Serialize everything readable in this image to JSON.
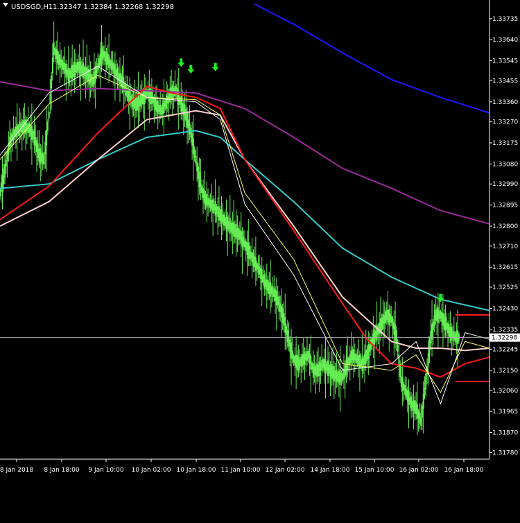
{
  "chart_header": {
    "symbol": "USDSGD,H1",
    "ohlc": "1.32347 1.32384 1.32268 1.32298"
  },
  "current_price_label": "1.32298",
  "colors": {
    "background": "#000000",
    "candles": "#66ee55",
    "axis": "#ffffff",
    "ma_fast": "#ffffff",
    "ma_yellow": "#ffff66",
    "ma_red": "#ff1a1a",
    "ma_pink": "#ffd0d0",
    "ma_cyan": "#33cccc",
    "ma_purple": "#9a2a9a",
    "ma_blue": "#1a1aff",
    "signal_arrows": "#22ee22",
    "level_lines": "#ff1a1a"
  },
  "chart_data": {
    "type": "line",
    "title": "USDSGD,H1",
    "ylim": [
      1.3175,
      1.338
    ],
    "y_ticks": [
      "1.33735",
      "1.33640",
      "1.33545",
      "1.33455",
      "1.33360",
      "1.33270",
      "1.33175",
      "1.33080",
      "1.32990",
      "1.32895",
      "1.32800",
      "1.32710",
      "1.32615",
      "1.32525",
      "1.32430",
      "1.32335",
      "1.32245",
      "1.32150",
      "1.32060",
      "1.31965",
      "1.31870",
      "1.31780"
    ],
    "x_ticks": [
      "8 Jan 2018",
      "8 Jan 18:00",
      "9 Jan 10:00",
      "10 Jan 02:00",
      "10 Jan 18:00",
      "11 Jan 10:00",
      "12 Jan 02:00",
      "14 Jan 18:00",
      "15 Jan 10:00",
      "16 Jan 02:00",
      "16 Jan 18:00"
    ],
    "x_range": [
      0,
      100
    ],
    "price_series": [
      [
        0,
        1.3295
      ],
      [
        1,
        1.3305
      ],
      [
        2,
        1.3318
      ],
      [
        3,
        1.3322
      ],
      [
        4,
        1.3324
      ],
      [
        5,
        1.3325
      ],
      [
        6,
        1.3324
      ],
      [
        7,
        1.332
      ],
      [
        8,
        1.3312
      ],
      [
        9,
        1.331
      ],
      [
        10,
        1.333
      ],
      [
        11,
        1.336
      ],
      [
        12,
        1.3355
      ],
      [
        13,
        1.3352
      ],
      [
        14,
        1.3348
      ],
      [
        15,
        1.335
      ],
      [
        16,
        1.3352
      ],
      [
        17,
        1.335
      ],
      [
        18,
        1.3348
      ],
      [
        19,
        1.3345
      ],
      [
        20,
        1.3352
      ],
      [
        21,
        1.3358
      ],
      [
        22,
        1.3355
      ],
      [
        23,
        1.3352
      ],
      [
        24,
        1.3348
      ],
      [
        25,
        1.3345
      ],
      [
        26,
        1.334
      ],
      [
        27,
        1.3336
      ],
      [
        28,
        1.3335
      ],
      [
        29,
        1.3337
      ],
      [
        30,
        1.334
      ],
      [
        31,
        1.3338
      ],
      [
        32,
        1.3334
      ],
      [
        33,
        1.3332
      ],
      [
        34,
        1.3336
      ],
      [
        35,
        1.334
      ],
      [
        36,
        1.3341
      ],
      [
        37,
        1.3335
      ],
      [
        38,
        1.333
      ],
      [
        39,
        1.3322
      ],
      [
        40,
        1.331
      ],
      [
        41,
        1.3298
      ],
      [
        42,
        1.3292
      ],
      [
        43,
        1.329
      ],
      [
        44,
        1.3288
      ],
      [
        45,
        1.3285
      ],
      [
        46,
        1.3282
      ],
      [
        47,
        1.328
      ],
      [
        48,
        1.3278
      ],
      [
        49,
        1.3276
      ],
      [
        50,
        1.3272
      ],
      [
        51,
        1.3268
      ],
      [
        52,
        1.3264
      ],
      [
        53,
        1.326
      ],
      [
        54,
        1.3255
      ],
      [
        55,
        1.3252
      ],
      [
        56,
        1.325
      ],
      [
        57,
        1.3245
      ],
      [
        58,
        1.3238
      ],
      [
        59,
        1.3228
      ],
      [
        60,
        1.322
      ],
      [
        61,
        1.3218
      ],
      [
        62,
        1.322
      ],
      [
        63,
        1.3222
      ],
      [
        64,
        1.3215
      ],
      [
        65,
        1.3215
      ],
      [
        66,
        1.3218
      ],
      [
        67,
        1.3216
      ],
      [
        68,
        1.3214
      ],
      [
        69,
        1.3212
      ],
      [
        70,
        1.3212
      ],
      [
        71,
        1.3218
      ],
      [
        72,
        1.3222
      ],
      [
        73,
        1.322
      ],
      [
        74,
        1.3218
      ],
      [
        75,
        1.3222
      ],
      [
        76,
        1.3228
      ],
      [
        77,
        1.3232
      ],
      [
        78,
        1.3236
      ],
      [
        79,
        1.324
      ],
      [
        80,
        1.3238
      ],
      [
        81,
        1.323
      ],
      [
        82,
        1.321
      ],
      [
        83,
        1.3205
      ],
      [
        84,
        1.32
      ],
      [
        85,
        1.3198
      ],
      [
        86,
        1.3192
      ],
      [
        87,
        1.321
      ],
      [
        88,
        1.323
      ],
      [
        89,
        1.324
      ],
      [
        90,
        1.324
      ],
      [
        91,
        1.3236
      ],
      [
        92,
        1.3232
      ],
      [
        93,
        1.323
      ],
      [
        94,
        1.323
      ]
    ],
    "series": [
      {
        "color_key": "ma_blue",
        "values": [
          [
            52,
            1.338
          ],
          [
            60,
            1.3371
          ],
          [
            70,
            1.3358
          ],
          [
            80,
            1.3346
          ],
          [
            90,
            1.3338
          ],
          [
            100,
            1.3331
          ]
        ]
      },
      {
        "color_key": "ma_purple",
        "values": [
          [
            0,
            1.3345
          ],
          [
            10,
            1.3341
          ],
          [
            20,
            1.3342
          ],
          [
            30,
            1.3341
          ],
          [
            40,
            1.334
          ],
          [
            50,
            1.3333
          ],
          [
            60,
            1.332
          ],
          [
            70,
            1.3306
          ],
          [
            80,
            1.3297
          ],
          [
            90,
            1.3287
          ],
          [
            100,
            1.3281
          ]
        ]
      },
      {
        "color_key": "ma_cyan",
        "values": [
          [
            0,
            1.3297
          ],
          [
            10,
            1.3299
          ],
          [
            20,
            1.331
          ],
          [
            30,
            1.332
          ],
          [
            40,
            1.3323
          ],
          [
            45,
            1.332
          ],
          [
            50,
            1.331
          ],
          [
            60,
            1.3291
          ],
          [
            70,
            1.327
          ],
          [
            80,
            1.3257
          ],
          [
            90,
            1.3247
          ],
          [
            100,
            1.3242
          ]
        ]
      },
      {
        "color_key": "ma_pink",
        "values": [
          [
            0,
            1.328
          ],
          [
            10,
            1.3291
          ],
          [
            20,
            1.331
          ],
          [
            30,
            1.3328
          ],
          [
            40,
            1.3332
          ],
          [
            45,
            1.333
          ],
          [
            50,
            1.331
          ],
          [
            60,
            1.328
          ],
          [
            70,
            1.3248
          ],
          [
            80,
            1.3228
          ],
          [
            85,
            1.3225
          ],
          [
            90,
            1.3225
          ],
          [
            95,
            1.3224
          ],
          [
            100,
            1.3225
          ]
        ]
      },
      {
        "color_key": "ma_red",
        "values": [
          [
            0,
            1.3283
          ],
          [
            10,
            1.3298
          ],
          [
            20,
            1.3322
          ],
          [
            30,
            1.3343
          ],
          [
            35,
            1.334
          ],
          [
            40,
            1.3338
          ],
          [
            45,
            1.3333
          ],
          [
            50,
            1.331
          ],
          [
            60,
            1.3278
          ],
          [
            70,
            1.3245
          ],
          [
            75,
            1.3229
          ],
          [
            80,
            1.3218
          ],
          [
            85,
            1.3216
          ],
          [
            90,
            1.3212
          ],
          [
            95,
            1.3218
          ],
          [
            100,
            1.3221
          ]
        ]
      },
      {
        "color_key": "ma_yellow",
        "values": [
          [
            0,
            1.331
          ],
          [
            10,
            1.3335
          ],
          [
            20,
            1.3348
          ],
          [
            30,
            1.3338
          ],
          [
            40,
            1.3337
          ],
          [
            45,
            1.333
          ],
          [
            50,
            1.3295
          ],
          [
            60,
            1.3265
          ],
          [
            70,
            1.3218
          ],
          [
            80,
            1.3215
          ],
          [
            85,
            1.3222
          ],
          [
            90,
            1.3205
          ],
          [
            95,
            1.3228
          ],
          [
            100,
            1.3225
          ]
        ]
      },
      {
        "color_key": "ma_fast",
        "values": [
          [
            0,
            1.3312
          ],
          [
            10,
            1.334
          ],
          [
            20,
            1.3352
          ],
          [
            30,
            1.3338
          ],
          [
            40,
            1.3336
          ],
          [
            45,
            1.3328
          ],
          [
            50,
            1.329
          ],
          [
            60,
            1.3258
          ],
          [
            70,
            1.3215
          ],
          [
            80,
            1.3218
          ],
          [
            85,
            1.3228
          ],
          [
            90,
            1.32
          ],
          [
            95,
            1.3232
          ],
          [
            100,
            1.3229
          ]
        ]
      }
    ],
    "arrows": [
      [
        37,
        1.3353
      ],
      [
        39,
        1.335
      ],
      [
        44,
        1.3351
      ],
      [
        90,
        1.3247
      ]
    ],
    "level_lines": [
      [
        93,
        100,
        1.324
      ],
      [
        93,
        100,
        1.321
      ]
    ],
    "current_price": 1.32298,
    "grid": false
  }
}
